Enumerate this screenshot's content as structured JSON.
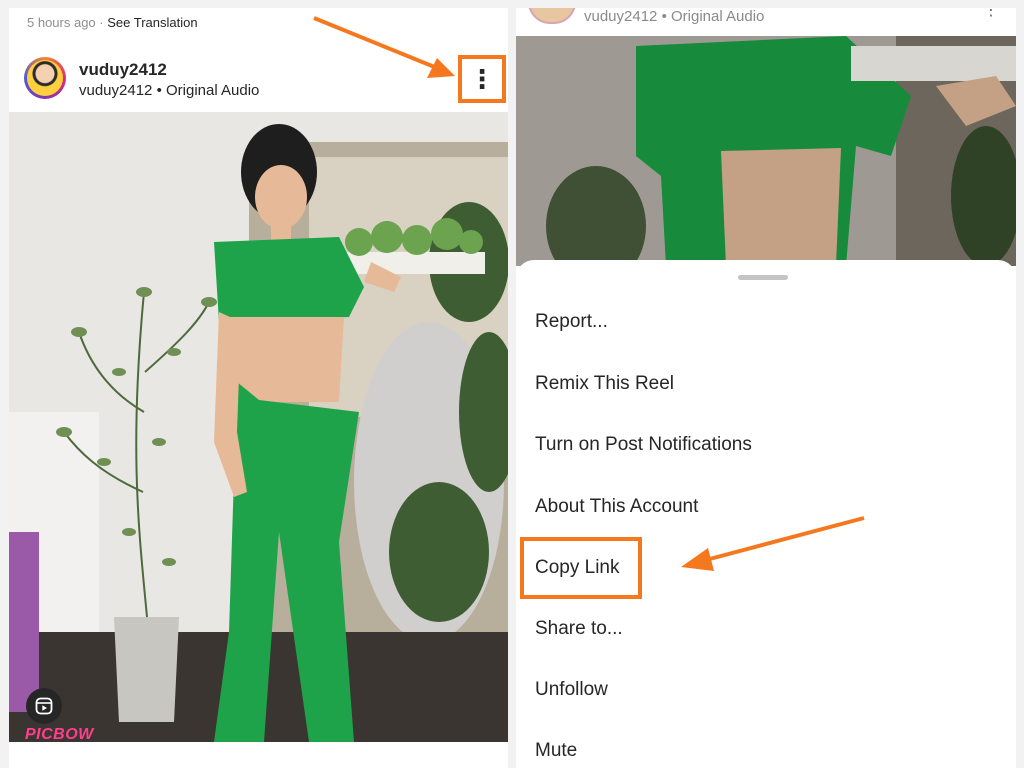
{
  "left": {
    "time_ago": "5 hours ago",
    "separator": " · ",
    "see_translation": "See Translation",
    "username": "vuduy2412",
    "subtitle": "vuduy2412 • Original Audio",
    "more_icon": "⋮",
    "reels_icon_name": "reels-icon",
    "watermark": "PICBOW"
  },
  "right": {
    "subtitle": "vuduy2412 • Original Audio",
    "more_icon": "⋮",
    "menu": [
      "Report...",
      "Remix This Reel",
      "Turn on Post Notifications",
      "About This Account",
      "Copy Link",
      "Share to...",
      "Unfollow",
      "Mute"
    ]
  },
  "colors": {
    "highlight": "#f5781e",
    "outfit_green": "#1fa34a",
    "text": "#262626",
    "secondary_text": "#8e8e8e"
  }
}
